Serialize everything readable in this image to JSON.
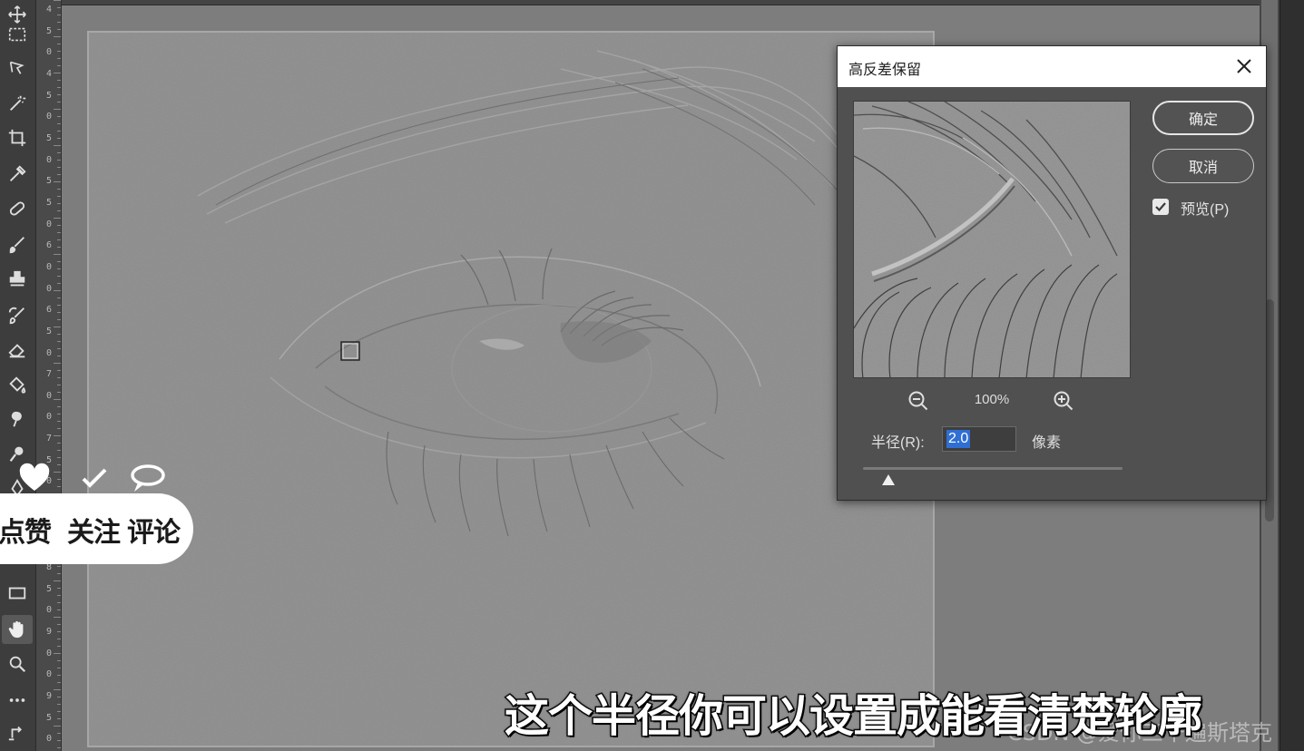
{
  "toolbar": {
    "tools": [
      {
        "name": "move-tool",
        "icon": "move-icon"
      },
      {
        "name": "marquee-tool",
        "icon": "rect-marquee-icon"
      },
      {
        "name": "lasso-tool",
        "icon": "lasso-icon"
      },
      {
        "name": "magic-wand-tool",
        "icon": "magic-wand-icon"
      },
      {
        "name": "crop-tool",
        "icon": "crop-icon"
      },
      {
        "name": "eyedropper-tool",
        "icon": "eyedropper-icon"
      },
      {
        "name": "healing-tool",
        "icon": "bandage-icon"
      },
      {
        "name": "brush-tool",
        "icon": "brush-icon"
      },
      {
        "name": "stamp-tool",
        "icon": "stamp-icon"
      },
      {
        "name": "history-brush-tool",
        "icon": "history-brush-icon"
      },
      {
        "name": "eraser-tool",
        "icon": "eraser-icon"
      },
      {
        "name": "paint-bucket-tool",
        "icon": "bucket-icon"
      },
      {
        "name": "smudge-tool",
        "icon": "smudge-icon"
      },
      {
        "name": "dodge-tool",
        "icon": "dodge-icon"
      },
      {
        "name": "pen-tool",
        "icon": "pen-icon"
      },
      {
        "name": "shape-tool",
        "icon": "rectangle-icon"
      },
      {
        "name": "hand-tool",
        "icon": "hand-icon"
      },
      {
        "name": "zoom-tool",
        "icon": "zoom-icon"
      },
      {
        "name": "more-tools",
        "icon": "ellipsis-icon"
      }
    ]
  },
  "ruler": {
    "numbers": [
      "4",
      "5",
      "0",
      "4",
      "5",
      "0",
      "5",
      "0",
      "5",
      "5",
      "0",
      "6",
      "0",
      "0",
      "6",
      "5",
      "0",
      "7",
      "0",
      "0",
      "7",
      "5",
      "0",
      "8",
      "0",
      "0",
      "8",
      "5",
      "0",
      "9",
      "0",
      "0",
      "9",
      "5",
      "0"
    ]
  },
  "dialog": {
    "title": "高反差保留",
    "ok_label": "确定",
    "cancel_label": "取消",
    "preview_label": "预览(P)",
    "preview_checked": true,
    "zoom_level": "100%",
    "radius_label": "半径(R):",
    "radius_value": "2.0",
    "radius_unit": "像素",
    "slider_value": 2.0
  },
  "social": {
    "like": "点赞",
    "follow": "关注",
    "comment": "评论"
  },
  "subtitle": "这个半径你可以设置成能看清楚轮廓",
  "watermark": "CSDN @爱你三千遍斯塔克",
  "colors": {
    "accent": "#2f6fd4",
    "canvas_gray": "#8a8a8a",
    "dialog_bg": "#505050"
  }
}
